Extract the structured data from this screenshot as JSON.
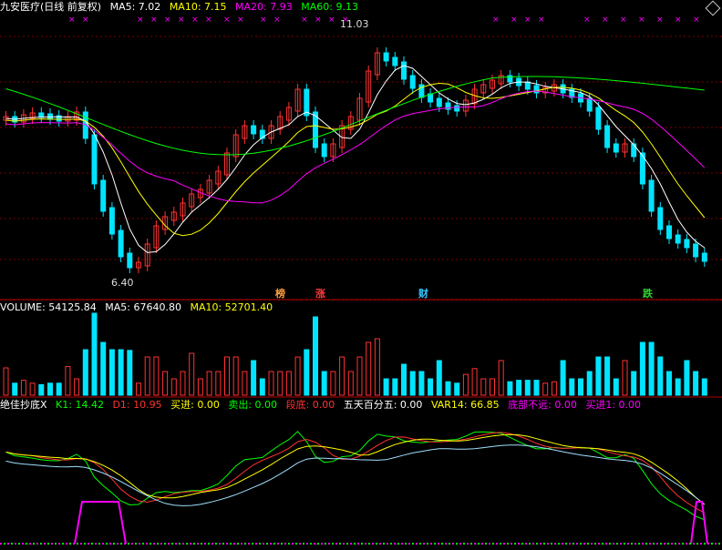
{
  "main": {
    "title": "九安医疗(日线 前复权)",
    "ma5": "MA5: 7.02",
    "ma10": "MA10: 7.15",
    "ma20": "MA20: 7.93",
    "ma60": "MA60: 9.13",
    "high_label": "11.03",
    "low_label": "6.40",
    "tags": [
      {
        "text": "榜",
        "color": "#ffa040"
      },
      {
        "text": "涨",
        "color": "#ff3b3b"
      },
      {
        "text": "财",
        "color": "#33c8ff"
      },
      {
        "text": "跌",
        "color": "#31d431"
      }
    ]
  },
  "volume": {
    "label": "VOLUME: 54125.84",
    "ma5": "MA5: 67640.80",
    "ma10": "MA10: 52701.40"
  },
  "indicator": {
    "title": "绝佳抄底X",
    "k1": "K1: 14.42",
    "d1": "D1: 10.95",
    "buy": "买进: 0.00",
    "sell": "卖出: 0.00",
    "bottom": "段底: 0.00",
    "five_day": "五天百分五: 0.00",
    "var14": "VAR14: 66.85",
    "not_far": "底部不远: 0.00",
    "buy1": "买进1: 0.00"
  },
  "colors": {
    "up": "#ff3232",
    "down": "#00e4ff",
    "ma5": "#ffffff",
    "ma10": "#ffff00",
    "ma20": "#ff00ff",
    "ma60": "#00ff00",
    "grid": "#7a0000"
  },
  "icons": {
    "corner": "diamond-icon"
  }
}
